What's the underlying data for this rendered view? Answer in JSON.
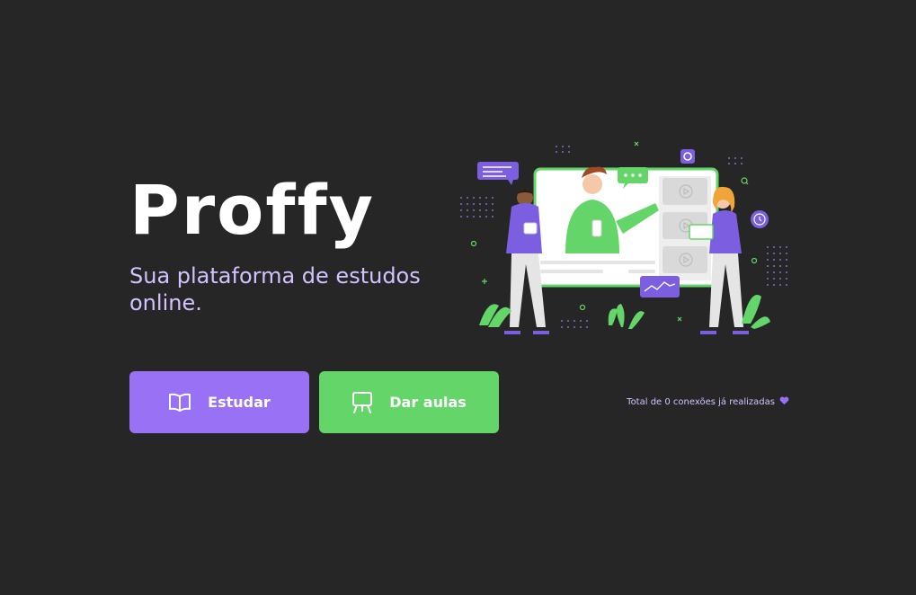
{
  "logo": {
    "text": "Proffy"
  },
  "tagline": "Sua plataforma de estudos online.",
  "buttons": {
    "study": {
      "label": "Estudar",
      "icon": "book-open-icon"
    },
    "teach": {
      "label": "Dar aulas",
      "icon": "presentation-board-icon"
    }
  },
  "connections": {
    "text": "Total de 0 conexões já realizadas",
    "icon": "heart-icon"
  },
  "colors": {
    "background": "#262626",
    "primary": "#9871f5",
    "secondary": "#64d569",
    "text_light": "#d4c2ff",
    "white": "#ffffff"
  }
}
